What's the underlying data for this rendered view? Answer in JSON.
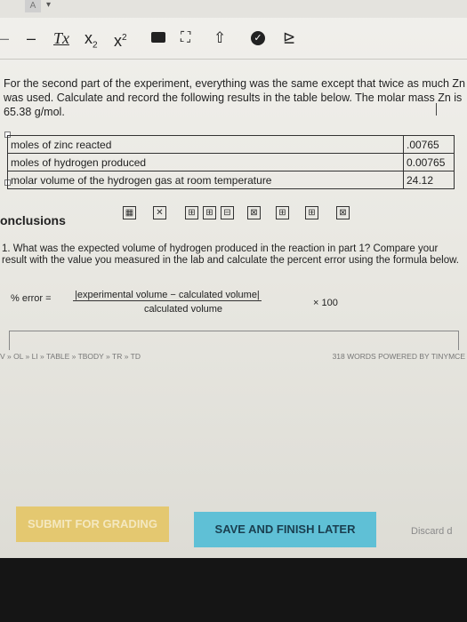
{
  "toolbar": {
    "color_swatch": "A",
    "sub_base": "x",
    "sub_mark": "2",
    "sup_base": "x",
    "sup_mark": "2",
    "clear_format": "Tx",
    "table_icon": "table-icon",
    "fullscreen_icon": "expand-icon",
    "plugin_icon": "puzzle-icon",
    "check_icon": "check-circle-icon",
    "chart_icon": "chart-icon"
  },
  "intro_paragraph": "For the second part of the experiment, everything was the same except that twice as much Zn was used. Calculate and record the following results in the table below. The molar mass Zn is 65.38 g/mol.",
  "table": {
    "rows": [
      {
        "label": "moles of zinc reacted",
        "value": ".00765"
      },
      {
        "label": "moles of hydrogen produced",
        "value": "0.00765"
      },
      {
        "label": "molar volume of the hydrogen gas at room temperature",
        "value": "24.12"
      }
    ]
  },
  "conclusions_heading": "onclusions",
  "question": "1. What was the expected volume of hydrogen produced in the reaction in part 1? Compare your result with the value you measured in the lab and calculate the percent error using the formula below.",
  "formula": {
    "label": "% error =",
    "numerator": "|experimental volume − calculated volume|",
    "denominator": "calculated volume",
    "multiplier": "× 100"
  },
  "statusbar": {
    "path": "V » OL » LI » TABLE » TBODY » TR » TD",
    "word_count": "318 WORDS POWERED BY TINYMCE"
  },
  "buttons": {
    "submit": "SUBMIT FOR GRADING",
    "save": "SAVE AND FINISH LATER",
    "discard": "Discard d"
  },
  "colors": {
    "submit_bg": "#e4c870",
    "save_bg": "#5fc0d6"
  }
}
